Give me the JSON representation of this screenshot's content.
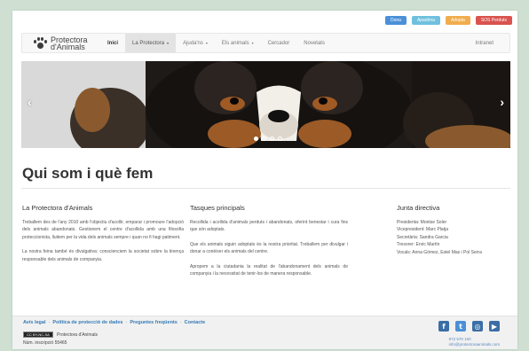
{
  "top_buttons": [
    {
      "label": "Dona",
      "color": "#4a90d9"
    },
    {
      "label": "Apadrina",
      "color": "#6fc0de"
    },
    {
      "label": "Adopta",
      "color": "#f0ad4e"
    },
    {
      "label": "SOS Perduts",
      "color": "#d9534f"
    }
  ],
  "logo": {
    "line1": "Protectora",
    "line2": "d'Animals"
  },
  "nav": {
    "home": "Inici",
    "items": [
      {
        "label": "La Protectora",
        "caret": "▾"
      },
      {
        "label": "Ajuda'ns",
        "caret": "▾"
      },
      {
        "label": "Els animals",
        "caret": "▾"
      },
      {
        "label": "Cercador",
        "caret": ""
      },
      {
        "label": "Novetats",
        "caret": ""
      }
    ],
    "intranet": "Intranet"
  },
  "carousel": {
    "prev": "‹",
    "next": "›",
    "slides": 4,
    "active": 1
  },
  "main": {
    "title": "Qui som i què fem"
  },
  "columns": {
    "c1": {
      "title": "La Protectora d'Animals",
      "p1": "Treballem des de l'any 2010 amb l'objectiu d'acollir, emparar i promoure l'adopció dels animals abandonats. Gestionem el centre d'acollida amb una filosofia proteccionista, lluitem per la vida dels animals sempre i quan no fi hagi patiment.",
      "p2": "La nostra feina també és divulgativa: conscienciem la societat sobre la tinença responsable dels animals de companyia."
    },
    "c2": {
      "title": "Tasques principals",
      "p1": "Recollida i acollida d'animals perduts i abandonats, oferint benestar i cura fins que són adoptats.",
      "p2": "Que els animals siguin adoptats és la nostra prioritat. Treballem per divulgar i donar a conèixer els animals del centre.",
      "p3": "Apropem a la ciutadania la realitat de l'abandonament dels animals de companyia i la necessitat de tenir-los de manera responsable."
    },
    "c3": {
      "title": "Junta directiva",
      "lines": [
        "Presidenta: Montse Soler",
        "Vicepresident: Marc Platja",
        "Secretària: Sandra Garcia",
        "Tresorer: Enric Martín",
        "Vocals: Anna Gómez, Estel Mas i Pol Serra"
      ]
    }
  },
  "footer": {
    "links": [
      "Avís legal",
      "Política de protecció de dades",
      "Preguntes freqüents",
      "Contacte"
    ],
    "separator": "·",
    "cc_badge": "CC BY-NC-SA",
    "cc_text": "Protectora d'Animals",
    "registry": "Núm. inscripció 55465",
    "social": [
      {
        "name": "facebook",
        "glyph": "f"
      },
      {
        "name": "twitter",
        "glyph": "t"
      },
      {
        "name": "instagram",
        "glyph": "◎"
      },
      {
        "name": "youtube",
        "glyph": "▶"
      }
    ],
    "phone": "972 570 100",
    "email": "info@protectoraanimals.com"
  },
  "colors": {
    "link": "#337ab7",
    "background": "#cfe0d2"
  }
}
